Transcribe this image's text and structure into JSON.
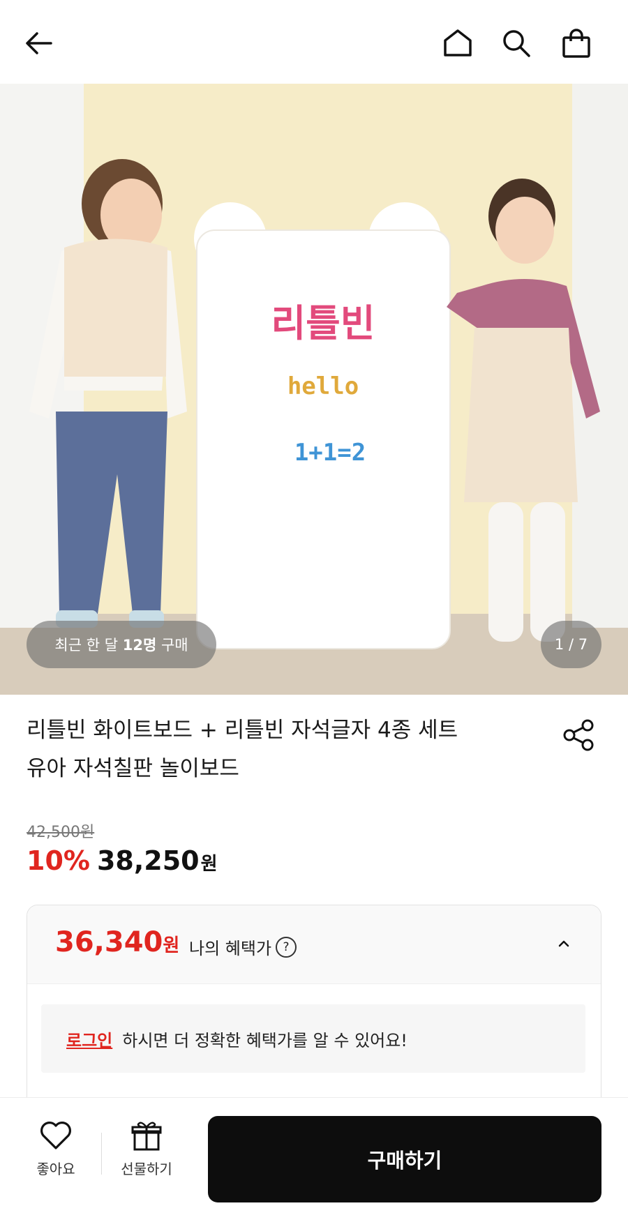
{
  "header": {
    "icons": [
      "back-arrow-icon",
      "home-icon",
      "search-icon",
      "shopping-bag-icon"
    ]
  },
  "hero": {
    "purchase_prefix": "최근 한 달 ",
    "purchase_count": "12명",
    "purchase_suffix": " 구매",
    "page_indicator": "1 / 7",
    "board_text": [
      "리틀빈",
      "hello",
      "1+1=2"
    ]
  },
  "product": {
    "title_line1": "리틀빈 화이트보드 + 리틀빈 자석글자 4종 세트",
    "title_line2": "유아 자석칠판 놀이보드",
    "original_price": "42,500원",
    "discount_percent": "10%",
    "sale_price": "38,250",
    "won": "원"
  },
  "benefit": {
    "price": "36,340",
    "won": "원",
    "label": "나의 혜택가",
    "help": "?",
    "login_link": "로그인",
    "login_text": "하시면 더 정확한 혜택가를 알 수 있어요!"
  },
  "bottom_bar": {
    "like_label": "좋아요",
    "gift_label": "선물하기",
    "buy_label": "구매하기"
  },
  "colors": {
    "accent_red": "#e0251f",
    "buy_button": "#0d0d0d"
  }
}
